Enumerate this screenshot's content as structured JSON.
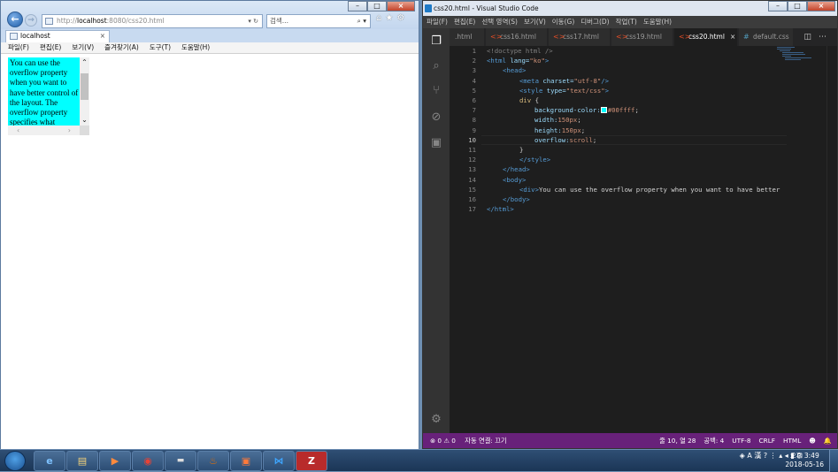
{
  "ie": {
    "address_prefix": "http://",
    "address_host": "localhost",
    "address_rest": ":8080/css20.html",
    "address_controls": "▾ ↻",
    "search_placeholder": "검색...",
    "search_controls": "⌕ ▾",
    "tab_title": "localhost",
    "tab_close": "×",
    "menu": [
      "파일(F)",
      "편집(E)",
      "보기(V)",
      "즐겨찾기(A)",
      "도구(T)",
      "도움말(H)"
    ],
    "demo_text": "You can use the overflow property when you want to have better control of the layout. The overflow property specifies what happens if content overflows an element's box.",
    "scroll_up": "⌃",
    "scroll_down": "⌄",
    "scroll_left": "‹",
    "scroll_right": "›"
  },
  "vscode": {
    "title": "css20.html - Visual Studio Code",
    "menu": [
      "파일(F)",
      "편집(E)",
      "선택 영역(S)",
      "보기(V)",
      "이동(G)",
      "디버그(D)",
      "작업(T)",
      "도움말(H)"
    ],
    "tabs": [
      {
        "label": ".html",
        "kind": "html"
      },
      {
        "label": "css16.html",
        "kind": "html"
      },
      {
        "label": "css17.html",
        "kind": "html"
      },
      {
        "label": "css19.html",
        "kind": "html"
      },
      {
        "label": "css20.html",
        "kind": "html",
        "active": true,
        "close": "×"
      },
      {
        "label": "default.css",
        "kind": "css"
      }
    ],
    "line_numbers": [
      "1",
      "2",
      "3",
      "4",
      "5",
      "6",
      "7",
      "8",
      "9",
      "10",
      "11",
      "12",
      "13",
      "14",
      "15",
      "16",
      "17"
    ],
    "code": {
      "l1": "<!doctype html />",
      "l2_tag": "<html",
      "l2_attr": " lang=",
      "l2_val": "\"ko\"",
      "l2_end": ">",
      "l3": "<head>",
      "l4_tag": "<meta",
      "l4_attr": " charset=",
      "l4_val": "\"utf-8\"",
      "l4_end": "/>",
      "l5_tag": "<style",
      "l5_attr": " type=",
      "l5_val": "\"text/css\"",
      "l5_end": ">",
      "l6_sel": "div",
      "l6_brace": " {",
      "l7_prop": "background-color:",
      "l7_val": "#00ffff",
      "l7_end": ";",
      "l8_prop": "width:",
      "l8_val": "150px",
      "l8_end": ";",
      "l9_prop": "height:",
      "l9_val": "150px",
      "l9_end": ";",
      "l10_prop": "overflow:",
      "l10_val": "scroll",
      "l10_end": ";",
      "l11": "}",
      "l12": "</style>",
      "l13": "</head>",
      "l14": "<body>",
      "l15_tag": "<div>",
      "l15_text": "You can use the overflow property when you want to have better",
      "l16": "</body>",
      "l17": "</html>"
    },
    "status": {
      "problems": "⊗ 0 ⚠ 0",
      "autoconnect": "자동 연결: 끄기",
      "position": "줄 10, 열 28",
      "spaces": "공백: 4",
      "encoding": "UTF-8",
      "eol": "CRLF",
      "language": "HTML",
      "smiley": "☻",
      "bell": "🔔"
    },
    "activity_icons": [
      "files-icon",
      "search-icon",
      "source-control-icon",
      "debug-icon",
      "extensions-icon",
      "settings-gear-icon"
    ]
  },
  "taskbar": {
    "tray_text": "◈ A 漢 ? ⋮ ▴ ◂ ▮ ⊡",
    "time": "오후 3:49",
    "date": "2018-05-16",
    "apps": [
      "internet-explorer",
      "file-explorer",
      "media-player",
      "chrome",
      "command-prompt",
      "java",
      "editor",
      "vscode",
      "filezilla"
    ]
  }
}
